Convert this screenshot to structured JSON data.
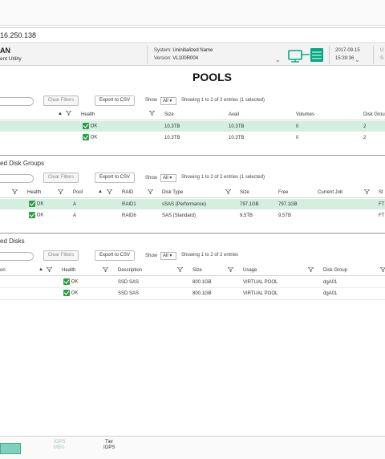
{
  "url": "16.250.138",
  "header": {
    "app_name_partial": "AN",
    "app_subtitle_partial": "ent Utility",
    "system_label": "System:",
    "system_value": "Uninitialized Name",
    "version_label": "Version:",
    "version_value": "VL100R004",
    "date": "2017-09-15",
    "time": "15:39:36",
    "right_partial_1": "U",
    "right_partial_2": "S"
  },
  "page_title": "POOLS",
  "pools": {
    "clear_filters": "Clear Filters",
    "export": "Export to CSV",
    "show_label": "Show",
    "show_value": "All",
    "entries_info": "Showing 1 to 2 of 2 entries (1 selected)",
    "columns": [
      "Health",
      "Size",
      "Avail",
      "Volumes",
      "Disk Grou"
    ],
    "rows": [
      {
        "health": "OK",
        "size": "10.3TB",
        "avail": "10.3TB",
        "volumes": "0",
        "disk_groups": "2"
      },
      {
        "health": "OK",
        "size": "10.3TB",
        "avail": "10.3TB",
        "volumes": "0",
        "disk_groups": "2"
      }
    ]
  },
  "disk_groups": {
    "section_title": "ed Disk Groups",
    "clear_filters": "Clear Filters",
    "export": "Export to CSV",
    "show_label": "Show",
    "show_value": "All",
    "entries_info": "Showing 1 to 2 of 2 entries (1 selected)",
    "columns": [
      "Health",
      "Pool",
      "RAID",
      "Disk Type",
      "Size",
      "Free",
      "Current Job",
      "St"
    ],
    "rows": [
      {
        "health": "OK",
        "pool": "A",
        "raid": "RAID1",
        "disk_type": "sSAS (Performance)",
        "size": "797.1GB",
        "free": "797.1GB",
        "job": "",
        "st": "FT"
      },
      {
        "health": "OK",
        "pool": "A",
        "raid": "RAID6",
        "disk_type": "SAS (Standard)",
        "size": "9.5TB",
        "free": "9.5TB",
        "job": "",
        "st": "FT"
      }
    ]
  },
  "disks": {
    "section_title": "ed Disks",
    "clear_filters": "Clear Filters",
    "export": "Export to CSV",
    "show_label": "Show",
    "show_value": "All",
    "entries_info": "Showing 1 to 2 of 2 entries",
    "columns": [
      "on",
      "Health",
      "Description",
      "Size",
      "Usage",
      "Disk Group"
    ],
    "rows": [
      {
        "health": "OK",
        "description": "SSD SAS",
        "size": "800.1GB",
        "usage": "VIRTUAL POOL",
        "disk_group": "dgA01"
      },
      {
        "health": "OK",
        "description": "SSD SAS",
        "size": "800.1GB",
        "usage": "VIRTUAL POOL",
        "disk_group": "dgA01"
      }
    ]
  },
  "footer": {
    "iops": "IOPS",
    "mbs": "MB/s",
    "tier": "Tier",
    "tier_iops": "IOPS"
  },
  "colors": {
    "ok_green": "#2e9e44",
    "selected_row": "#d4eee0",
    "accent": "#01a982"
  }
}
